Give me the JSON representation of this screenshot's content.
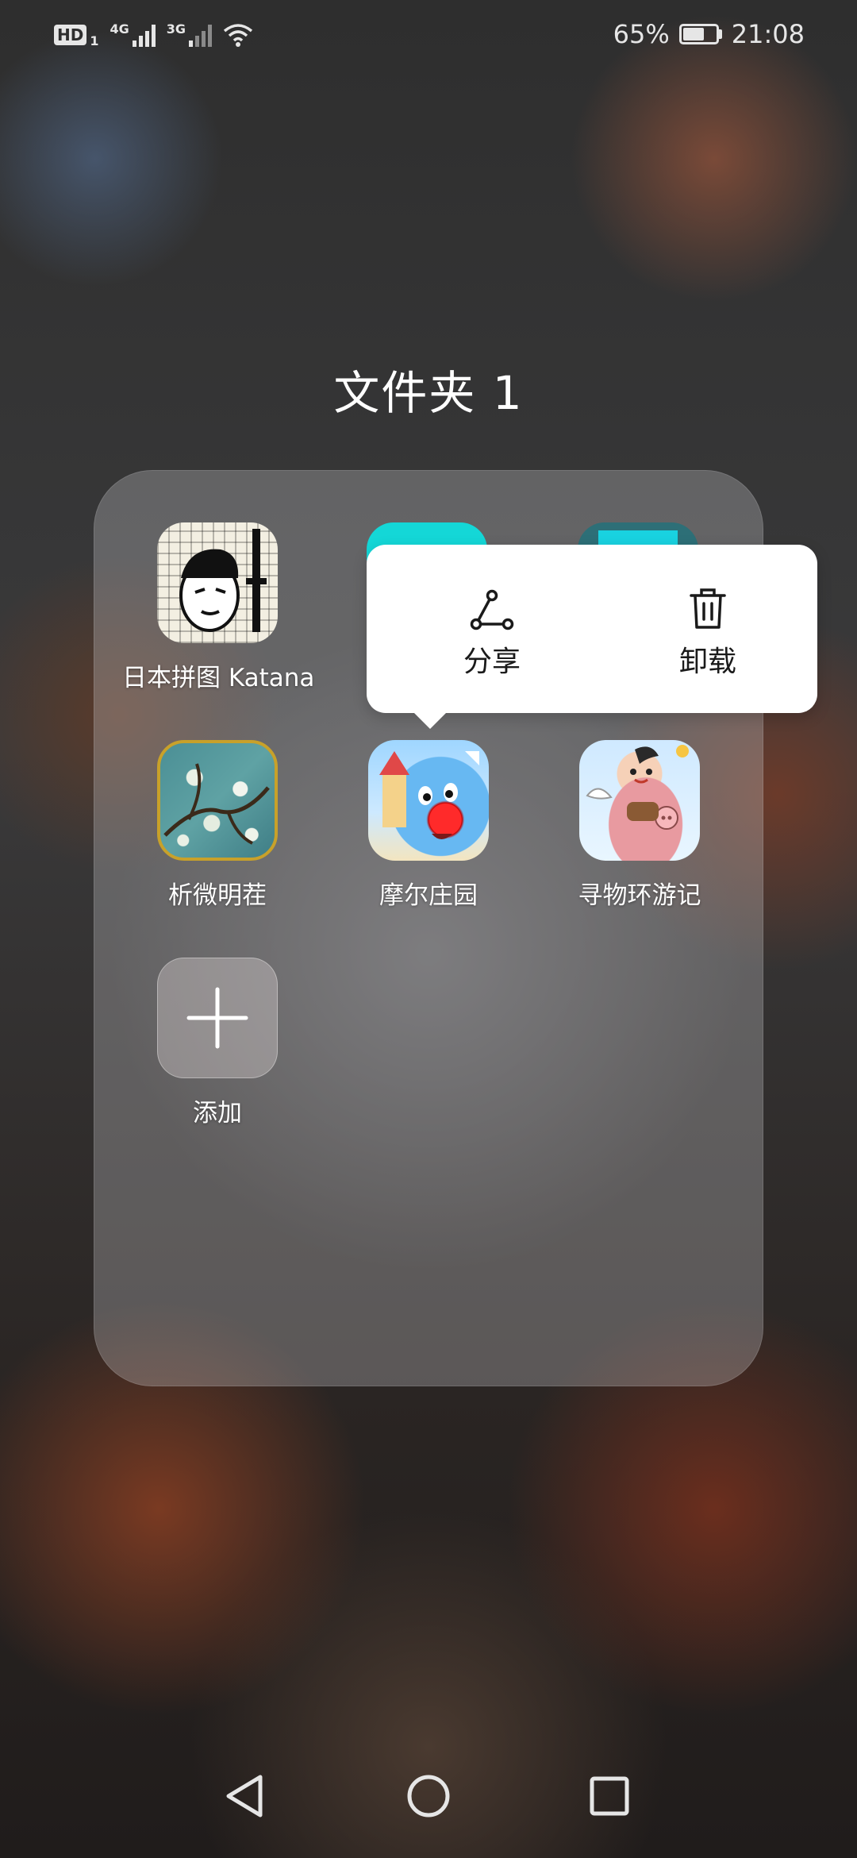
{
  "status_bar": {
    "hd": "HD",
    "sim": "1",
    "net1": "4G",
    "net2": "3G",
    "battery_percent": "65%",
    "battery_level": 0.65,
    "time": "21:08"
  },
  "folder": {
    "title": "文件夹 1",
    "apps": [
      {
        "label": "日本拼图 Katana",
        "icon": "katana-puzzle-icon"
      },
      {
        "label": "析微明茬",
        "icon": "almond-blossom-icon"
      },
      {
        "label": "摩尔庄园",
        "icon": "mole-manor-icon"
      },
      {
        "label": "寻物环游记",
        "icon": "flying-pig-icon"
      },
      {
        "label": "添加",
        "icon": "plus-icon"
      }
    ]
  },
  "context_menu": {
    "share": "分享",
    "uninstall": "卸载"
  },
  "colors": {
    "popup_bg": "#ffffff",
    "text_white": "#ffffff",
    "teal_icon": "#14d7d7"
  }
}
